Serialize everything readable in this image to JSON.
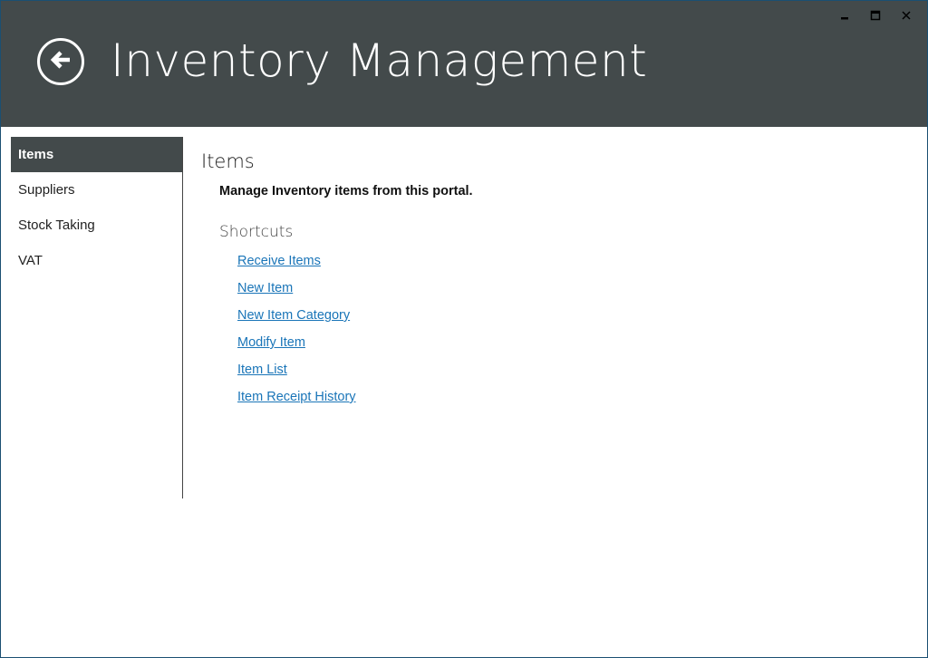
{
  "window": {
    "title": "Inventory Management",
    "controls": {
      "minimize": "minimize-icon",
      "maximize": "maximize-icon",
      "close": "close-icon"
    },
    "back_icon": "back-arrow-circle-icon"
  },
  "sidebar": {
    "items": [
      {
        "label": "Items",
        "active": true
      },
      {
        "label": "Suppliers",
        "active": false
      },
      {
        "label": "Stock Taking",
        "active": false
      },
      {
        "label": "VAT",
        "active": false
      }
    ]
  },
  "main": {
    "title": "Items",
    "description": "Manage Inventory items from this portal.",
    "shortcuts_title": "Shortcuts",
    "shortcuts": [
      "Receive Items",
      "New Item",
      "New Item Category",
      "Modify Item",
      "Item List",
      "Item Receipt History"
    ]
  },
  "colors": {
    "header_bg": "#434a4b",
    "link": "#1a75b8",
    "window_border": "#1b4f72"
  }
}
